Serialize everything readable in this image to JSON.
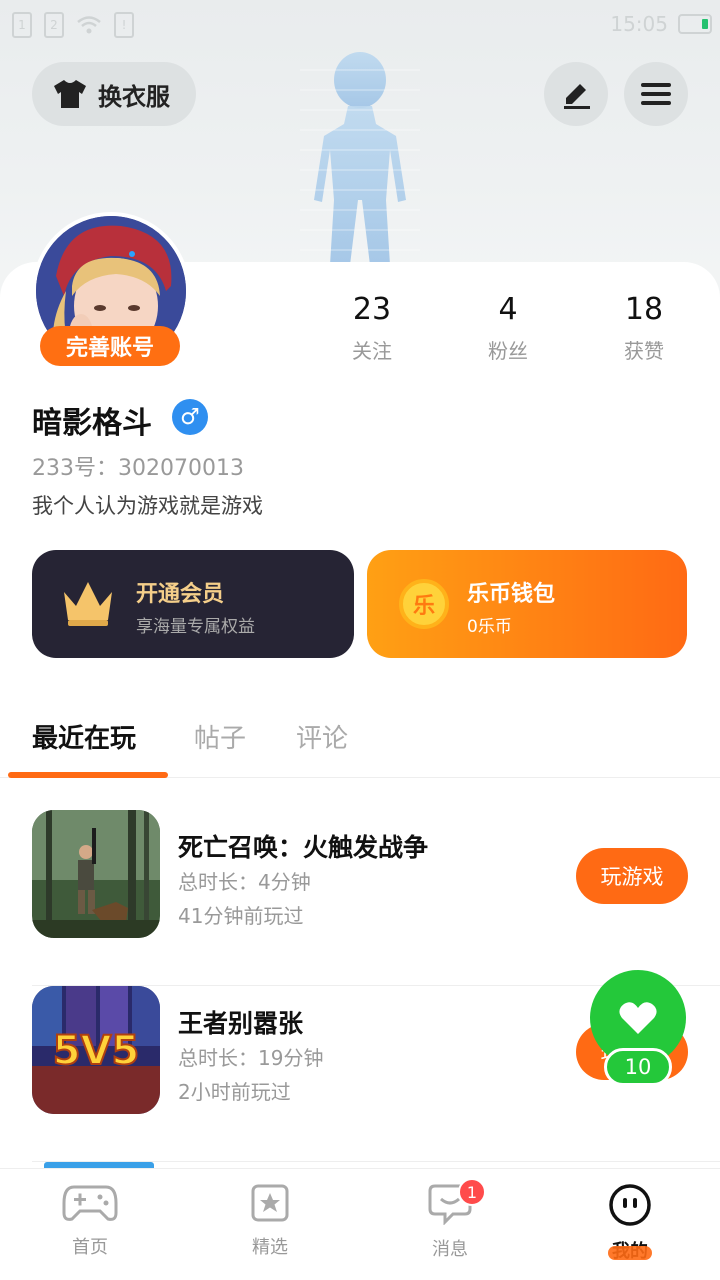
{
  "status_bar": {
    "sim1": "1",
    "sim2": "2",
    "time": "15:05"
  },
  "header": {
    "outfit_label": "换衣服"
  },
  "profile": {
    "complete_label": "完善账号",
    "nickname": "暗影格斗",
    "gender_symbol": "♂",
    "uid": "233号：302070013",
    "bio": "我个人认为游戏就是游戏",
    "stats": [
      {
        "value": "23",
        "label": "关注"
      },
      {
        "value": "4",
        "label": "粉丝"
      },
      {
        "value": "18",
        "label": "获赞"
      }
    ]
  },
  "promo": {
    "vip_title": "开通会员",
    "vip_sub": "享海量专属权益",
    "wallet_coin": "乐",
    "wallet_title": "乐币钱包",
    "wallet_sub": "0乐币"
  },
  "tabs": [
    {
      "label": "最近在玩",
      "active": true
    },
    {
      "label": "帖子",
      "active": false
    },
    {
      "label": "评论",
      "active": false
    }
  ],
  "games": [
    {
      "name": "死亡召唤：火触发战争",
      "duration": "总时长：4分钟",
      "last_played": "41分钟前玩过",
      "action": "玩游戏"
    },
    {
      "name": "王者别嚣张",
      "duration": "总时长：19分钟",
      "last_played": "2小时前玩过",
      "action": "玩游戏"
    }
  ],
  "like_float": {
    "count": "10"
  },
  "bottom_nav": [
    {
      "label": "首页",
      "icon": "gamepad-icon"
    },
    {
      "label": "精选",
      "icon": "star-bookmark-icon"
    },
    {
      "label": "消息",
      "icon": "chat-bubble-icon",
      "badge": "1"
    },
    {
      "label": "我的",
      "icon": "smiley-face-icon",
      "active": true
    }
  ],
  "colors": {
    "accent": "#ff6a14",
    "like_green": "#24c83a",
    "vip_dark": "#262434",
    "gender_blue": "#2f8ff0"
  }
}
